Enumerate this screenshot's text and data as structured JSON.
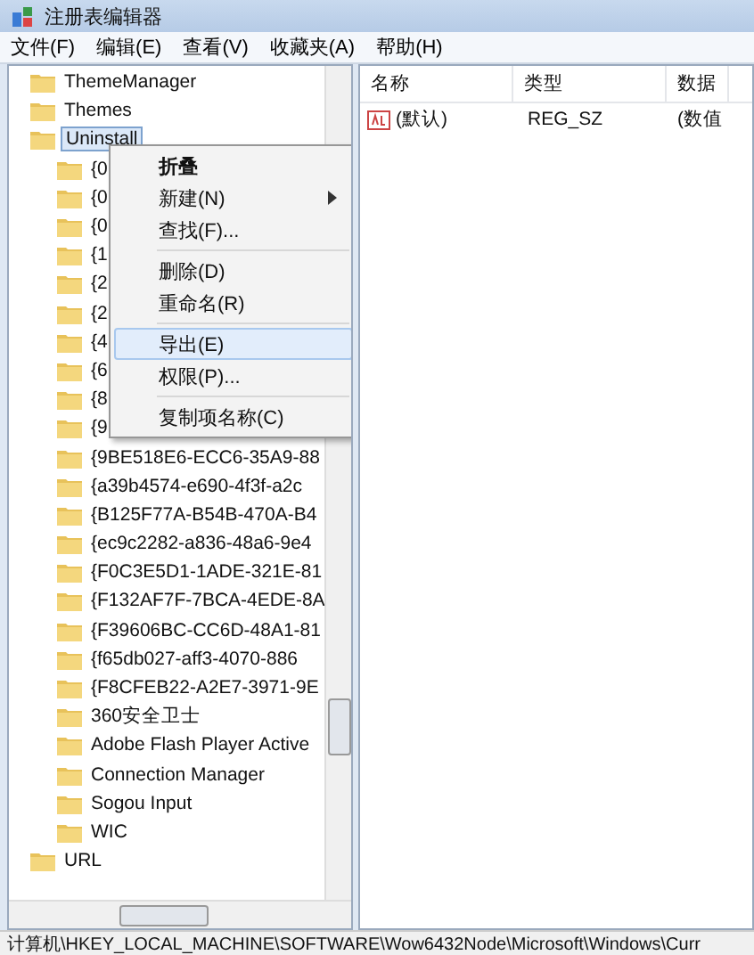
{
  "window": {
    "title": "注册表编辑器"
  },
  "menu_bar": [
    "文件(F)",
    "编辑(E)",
    "查看(V)",
    "收藏夹(A)",
    "帮助(H)"
  ],
  "tree": [
    {
      "label": "ThemeManager",
      "selected": false
    },
    {
      "label": "Themes",
      "selected": false
    },
    {
      "label": "Uninstall",
      "selected": true,
      "expanded": true,
      "children": [
        {
          "label": "{0"
        },
        {
          "label": "{0"
        },
        {
          "label": "{0"
        },
        {
          "label": "{1"
        },
        {
          "label": "{2"
        },
        {
          "label": "{2"
        },
        {
          "label": "{4"
        },
        {
          "label": "{6"
        },
        {
          "label": "{8"
        },
        {
          "label": "{9"
        },
        {
          "label": "{9BE518E6-ECC6-35A9-88"
        },
        {
          "label": "{a39b4574-e690-4f3f-a2c"
        },
        {
          "label": "{B125F77A-B54B-470A-B4"
        },
        {
          "label": "{ec9c2282-a836-48a6-9e4"
        },
        {
          "label": "{F0C3E5D1-1ADE-321E-81"
        },
        {
          "label": "{F132AF7F-7BCA-4EDE-8A"
        },
        {
          "label": "{F39606BC-CC6D-48A1-81"
        },
        {
          "label": "{f65db027-aff3-4070-886"
        },
        {
          "label": "{F8CFEB22-A2E7-3971-9E"
        },
        {
          "label": "360安全卫士"
        },
        {
          "label": "Adobe Flash Player Active"
        },
        {
          "label": "Connection Manager"
        },
        {
          "label": "Sogou Input"
        },
        {
          "label": "WIC"
        }
      ]
    },
    {
      "label": "URL",
      "selected": false
    }
  ],
  "context_menu": [
    {
      "kind": "item",
      "label": "折叠",
      "bold": true,
      "selected": false
    },
    {
      "kind": "item",
      "label": "新建(N)",
      "submenu": true,
      "selected": false
    },
    {
      "kind": "item",
      "label": "查找(F)...",
      "selected": false
    },
    {
      "kind": "separator"
    },
    {
      "kind": "item",
      "label": "删除(D)",
      "selected": false
    },
    {
      "kind": "item",
      "label": "重命名(R)",
      "selected": false
    },
    {
      "kind": "separator"
    },
    {
      "kind": "item",
      "label": "导出(E)",
      "selected": true
    },
    {
      "kind": "item",
      "label": "权限(P)...",
      "selected": false
    },
    {
      "kind": "separator"
    },
    {
      "kind": "item",
      "label": "复制项名称(C)",
      "selected": false
    }
  ],
  "values_table": {
    "columns": [
      "名称",
      "类型",
      "数据"
    ],
    "rows": [
      {
        "name": "(默认)",
        "type": "REG_SZ",
        "data": "(数值"
      }
    ]
  },
  "status_bar": "计算机\\HKEY_LOCAL_MACHINE\\SOFTWARE\\Wow6432Node\\Microsoft\\Windows\\Curr"
}
